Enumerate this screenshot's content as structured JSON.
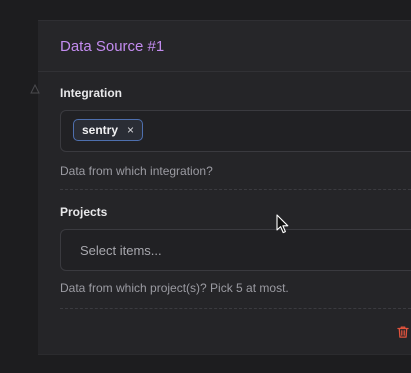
{
  "card": {
    "title": "Data Source #1"
  },
  "integration": {
    "label": "Integration",
    "tags": [
      {
        "text": "sentry",
        "remove_glyph": "×"
      }
    ],
    "help": "Data from which integration?"
  },
  "projects": {
    "label": "Projects",
    "placeholder": "Select items...",
    "help": "Data from which project(s)? Pick 5 at most."
  },
  "icons": {
    "delete": "trash-icon",
    "collapse": "triangle-icon",
    "cursor": "mouse-pointer-icon"
  },
  "colors": {
    "title_accent": "#c38cf0",
    "tag_border": "#4e6fae",
    "delete_icon": "#e0533d"
  }
}
